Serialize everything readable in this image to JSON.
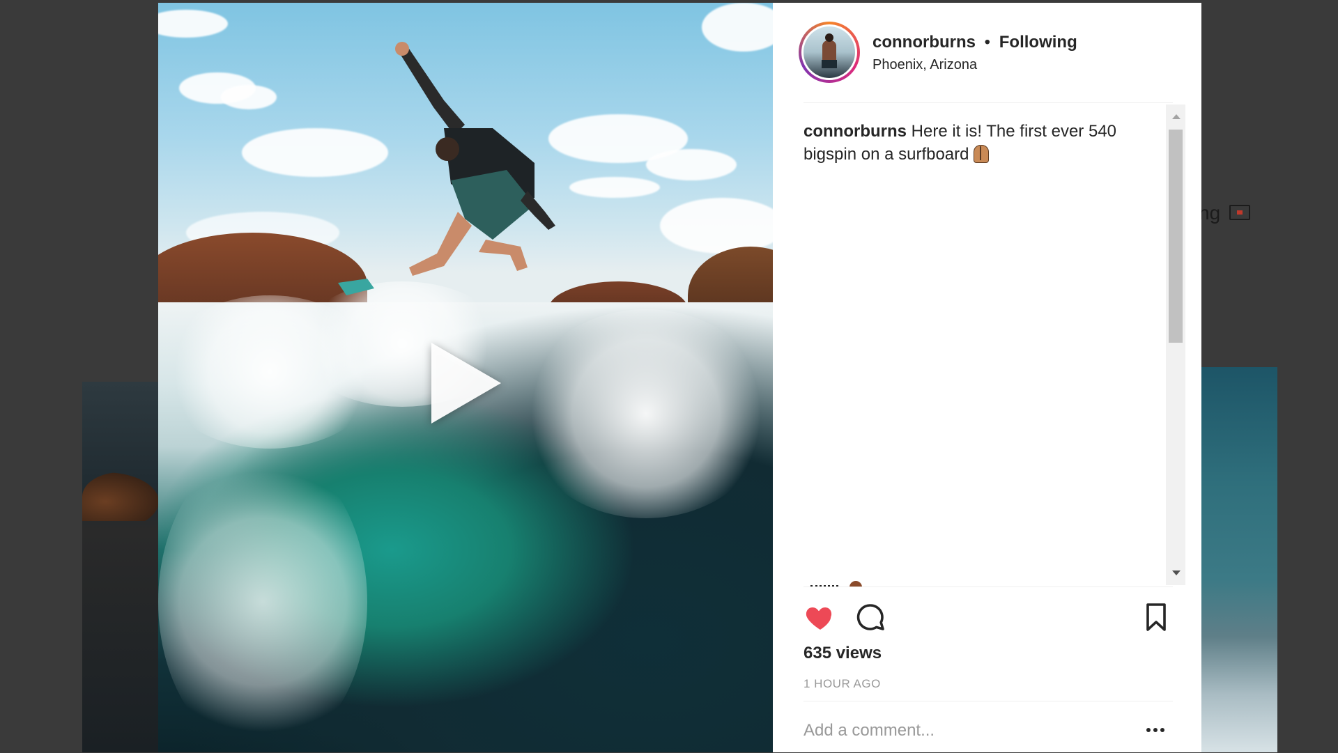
{
  "post": {
    "username": "connorburns",
    "separator": "•",
    "follow_status": "Following",
    "location": "Phoenix, Arizona",
    "caption_user": "connorburns",
    "caption_text": " Here it is! The first ever 540 bigspin on a surfboard",
    "caption_emoji_icon": "praying-hands-icon",
    "views": "635 views",
    "timestamp": "1 HOUR AGO"
  },
  "comment": {
    "placeholder": "Add a comment..."
  },
  "background": {
    "right_peek_text": "ng"
  },
  "icons": {
    "like": "heart-filled-icon",
    "comment": "speech-bubble-icon",
    "save": "bookmark-icon",
    "play": "play-icon",
    "more": "ellipsis-icon"
  },
  "colors": {
    "like": "#ed4956",
    "text": "#262626",
    "muted": "#999999",
    "overlay": "#3a3a3a"
  }
}
